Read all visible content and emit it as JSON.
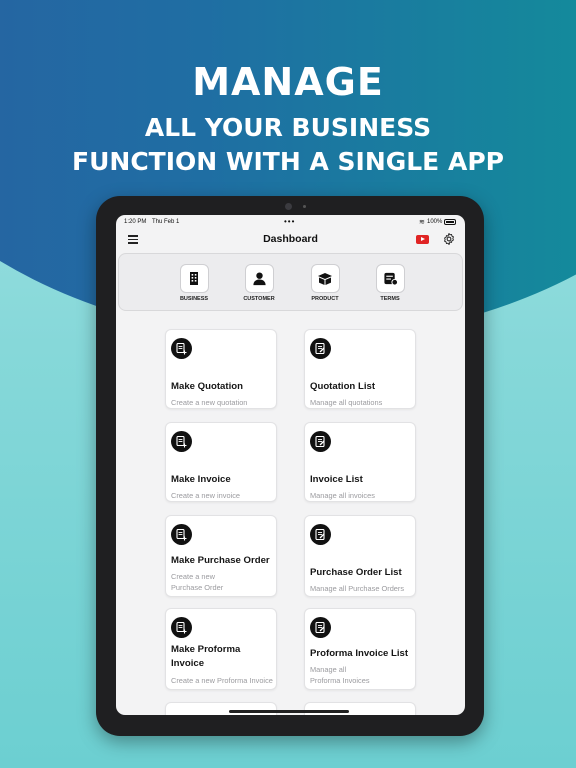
{
  "headline": {
    "line1": "MANAGE",
    "line2": "ALL YOUR BUSINESS",
    "line3": "FUNCTION  WITH A SINGLE APP"
  },
  "status_bar": {
    "time": "1:20 PM",
    "date": "Thu Feb 1",
    "dots": "•••",
    "battery": "100%"
  },
  "nav": {
    "title": "Dashboard",
    "icons": [
      "menu-icon",
      "youtube-icon",
      "gear-icon"
    ]
  },
  "quick_actions": [
    {
      "label": "BUSINESS",
      "icon": "building-icon"
    },
    {
      "label": "CUSTOMER",
      "icon": "user-icon"
    },
    {
      "label": "PRODUCT",
      "icon": "box-icon"
    },
    {
      "label": "TERMS",
      "icon": "terms-icon"
    }
  ],
  "cards": [
    {
      "title": "Make Quotation",
      "subtitle": "Create a new quotation",
      "icon": "doc-add-icon"
    },
    {
      "title": "Quotation List",
      "subtitle": "Manage all quotations",
      "icon": "doc-list-icon"
    },
    {
      "title": "Make Invoice",
      "subtitle": "Create a new invoice",
      "icon": "doc-add-icon"
    },
    {
      "title": "Invoice List",
      "subtitle": "Manage all invoices",
      "icon": "doc-list-icon"
    },
    {
      "title": "Make Purchase Order",
      "subtitle": "Create a new\nPurchase Order",
      "icon": "doc-add-icon"
    },
    {
      "title": "Purchase Order List",
      "subtitle": "Manage all Purchase Orders",
      "icon": "doc-list-icon"
    },
    {
      "title": "Make Proforma\nInvoice",
      "subtitle": "Create a new Proforma Invoice",
      "icon": "doc-add-icon"
    },
    {
      "title": "Proforma Invoice List",
      "subtitle": "Manage all\nProforma Invoices",
      "icon": "doc-list-icon"
    }
  ],
  "colors": {
    "bg_blue": "#2a5fa2",
    "bg_teal": "#7fd3d4",
    "youtube_red": "#e02424"
  }
}
